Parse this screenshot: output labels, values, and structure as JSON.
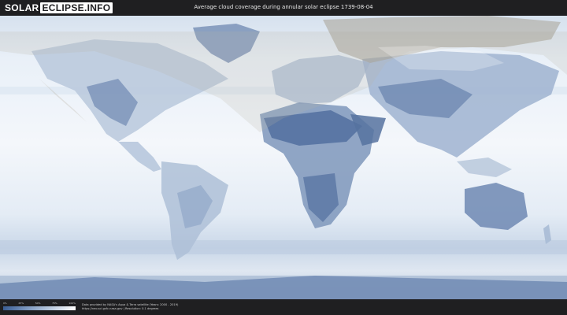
{
  "header": {
    "logo_part1": "SOLAR",
    "logo_part2": "ECLIPSE.INFO",
    "title": "Average cloud coverage during annular solar eclipse 1739-08-04"
  },
  "legend": {
    "ticks": [
      "0%",
      "25%",
      "50%",
      "75%",
      "100%"
    ],
    "colors": {
      "clear": "#ffffff",
      "cloudy": "#3a5d93"
    }
  },
  "footer": {
    "line1": "Data provided by NASA's Aqua & Terra satellite (Years: 2000 - 2019)",
    "line2": "https://neo.sci.gsfc.nasa.gov | Resolution: 0.1 degrees"
  },
  "map": {
    "projection": "equirectangular",
    "eclipse_region_color": "#b8b2a6"
  }
}
